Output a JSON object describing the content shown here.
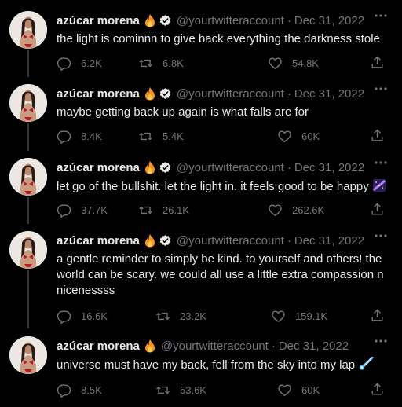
{
  "user": {
    "name": "azúcar morena",
    "handle": "@yourtwitteraccount",
    "separator": "·"
  },
  "tweets": [
    {
      "date": "Dec 31, 2022",
      "text": "the light is cominnn to give back everything the darkness stole",
      "replies": "6.2K",
      "retweets": "6.8K",
      "likes": "54.8K",
      "verified": true
    },
    {
      "date": "Dec 31, 2022",
      "text": "maybe getting back up again is what falls are for",
      "replies": "8.4K",
      "retweets": "5.4K",
      "likes": "60K",
      "verified": true
    },
    {
      "date": "Dec 31, 2022",
      "text": "let go of the bullshit. let the light in. it feels good to be happy",
      "emoji": "milky-way-emoji",
      "replies": "37.7K",
      "retweets": "26.1K",
      "likes": "262.6K",
      "verified": true
    },
    {
      "date": "Dec 31, 2022",
      "text": "a gentle reminder to simply be kind. to yourself and others! the world can be scary. we could all use a little extra compassion n nicenessss",
      "replies": "16.6K",
      "retweets": "23.2K",
      "likes": "159.1K",
      "verified": true
    },
    {
      "date": "Dec 31, 2022",
      "text": "universe must have my back, fell from the sky into my lap",
      "emoji": "comet-emoji",
      "replies": "8.5K",
      "retweets": "53.6K",
      "likes": "60K",
      "verified": false
    }
  ],
  "colors": {
    "background": "#000000",
    "text": "#e7e9ea",
    "muted": "#71767b",
    "thread_line": "#333639",
    "verified_badge": "#e7e9ea"
  },
  "icons": [
    "fire-emoji",
    "verified-icon",
    "more-icon",
    "reply-icon",
    "retweet-icon",
    "like-icon",
    "share-icon"
  ]
}
